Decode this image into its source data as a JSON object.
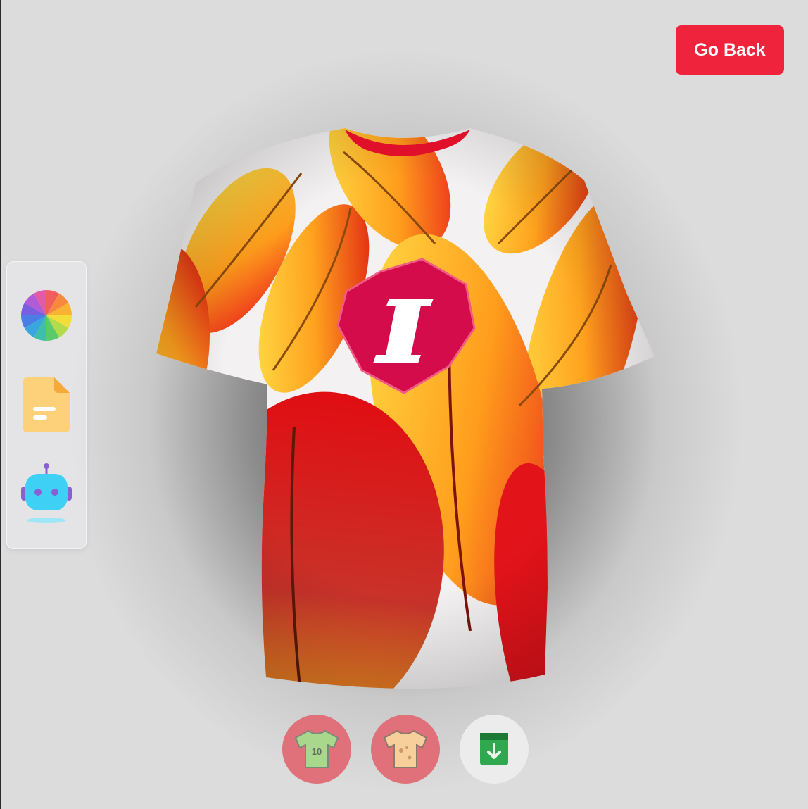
{
  "header": {
    "go_back_label": "Go Back"
  },
  "colors": {
    "accent": "#ef233c",
    "toolbar_red": "#e0707a",
    "logo_badge": "#d40c4c"
  },
  "sidebar": {
    "tools": [
      {
        "name": "color-wheel-icon"
      },
      {
        "name": "file-icon"
      },
      {
        "name": "ai-robot-icon"
      }
    ]
  },
  "shirt": {
    "logo_letter": "I"
  },
  "bottom_toolbar": {
    "buttons": [
      {
        "name": "jersey-number-shirt-icon",
        "number": "10"
      },
      {
        "name": "full-texture-shirt-icon"
      },
      {
        "name": "download-icon"
      }
    ]
  }
}
